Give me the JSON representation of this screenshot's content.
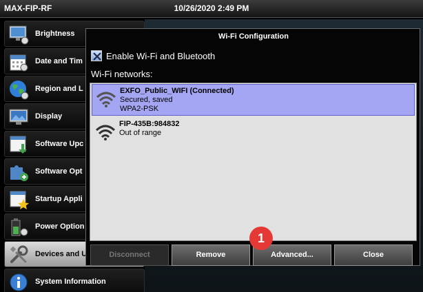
{
  "topbar": {
    "device_name": "MAX-FIP-RF",
    "datetime": "10/26/2020 2:49 PM"
  },
  "sidebar": {
    "items": [
      {
        "label": "Brightness",
        "icon": "brightness-monitor-icon"
      },
      {
        "label": "Date and Tim",
        "icon": "calendar-icon"
      },
      {
        "label": "Region and L",
        "icon": "globe-icon"
      },
      {
        "label": "Display",
        "icon": "display-icon"
      },
      {
        "label": "Software Upc",
        "icon": "software-update-icon"
      },
      {
        "label": "Software Opt",
        "icon": "puzzle-icon"
      },
      {
        "label": "Startup Appli",
        "icon": "startup-star-icon"
      },
      {
        "label": "Power Option",
        "icon": "battery-icon"
      },
      {
        "label": "Devices and U",
        "icon": "tools-icon",
        "active": true
      },
      {
        "label": "System Information",
        "icon": "info-icon"
      }
    ]
  },
  "dialog": {
    "title": "Wi-Fi Configuration",
    "enable_label": "Enable Wi-Fi and Bluetooth",
    "enable_checked": true,
    "networks_label": "Wi-Fi networks:",
    "networks": [
      {
        "name": "EXFO_Public_WIFI (Connected)",
        "status": "Secured, saved",
        "security": "WPA2-PSK",
        "selected": true
      },
      {
        "name": "FIP-435B:984832",
        "status": "Out of range",
        "security": "",
        "selected": false
      }
    ],
    "buttons": {
      "disconnect": "Disconnect",
      "remove": "Remove",
      "advanced": "Advanced...",
      "close": "Close"
    },
    "callout_number": "1"
  },
  "colors": {
    "selected_row": "#a5a6f3",
    "callout": "#e53935"
  }
}
